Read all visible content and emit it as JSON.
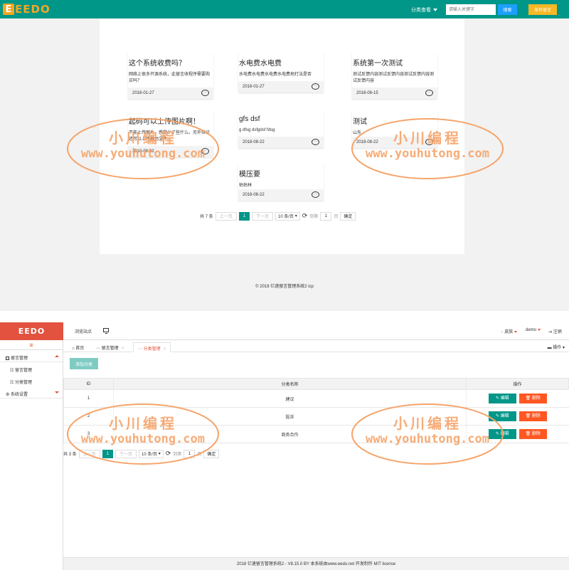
{
  "front": {
    "logo": {
      "mark": "E",
      "text": "EEDO"
    },
    "nav": {
      "category_menu": "分类查看",
      "search_placeholder": "请输入关键字",
      "search_button": "搜索",
      "post_button": "发布留言"
    },
    "cards": [
      {
        "title": "这个系统收费吗？",
        "summary": "网络上很多开源系统，此留言收程序需要购买吗？",
        "date": "2016-01-27"
      },
      {
        "title": "水电费水电费",
        "summary": "水电费水电费水电费水电费地打法是否",
        "date": "2016-01-27"
      },
      {
        "title": "系统第一次测试",
        "summary": "测试反馈内容测试反馈内容测试反馈内容测试反馈内容",
        "date": "2018-08-15"
      },
      {
        "title": "起码可以上传图片啊！",
        "summary": "不能上传图片，感觉少了些什么。另外验证还可以上传其他文件。",
        "date": "2018-08-22"
      },
      {
        "title": "gfs dsf",
        "summary": "g dfsg dsfgdsf fdsg",
        "date": "2018-08-22"
      },
      {
        "title": "测试",
        "summary": "山东",
        "date": "2018-08-22"
      },
      {
        "title": "模压要",
        "summary": "枯枯林",
        "date": "2018-08-22"
      }
    ],
    "pager": {
      "total": "共 7 条",
      "prev": "上一页",
      "current": "1",
      "next": "下一页",
      "page_size": "10 条/页",
      "goto_label": "到第",
      "goto_value": "1",
      "page_unit": "页",
      "confirm": "确定"
    },
    "footer": "© 2018 亿速留言管理系统2  icp"
  },
  "admin": {
    "logo": "EEDO",
    "header": {
      "preview": "浏览站点",
      "skin": "皮肤",
      "user": "demo",
      "logout": "注销"
    },
    "sidebar": {
      "toggle": "≡",
      "groups": [
        {
          "label": "留言管理",
          "items": [
            "留言管理",
            "分类管理"
          ]
        },
        {
          "label": "系统设置",
          "items": []
        }
      ]
    },
    "tabs": [
      {
        "label": "首页",
        "closable": false
      },
      {
        "label": "留言管理",
        "closable": true
      },
      {
        "label": "分类管理",
        "closable": true
      }
    ],
    "tab_ops": "操作",
    "add_button": "添加分类",
    "table": {
      "headers": [
        "ID",
        "分类名称",
        "操作"
      ],
      "rows": [
        {
          "id": "1",
          "name": "建议"
        },
        {
          "id": "2",
          "name": "投诉"
        },
        {
          "id": "3",
          "name": "商务合作"
        }
      ],
      "edit_label": "编辑",
      "delete_label": "删除"
    },
    "pager": {
      "total": "共 3 条",
      "prev": "上一页",
      "current": "1",
      "next": "下一页",
      "page_size": "10 条/页",
      "goto_label": "到第",
      "goto_value": "1",
      "page_unit": "页",
      "confirm": "确定"
    },
    "footer": "2018   亿速留言管理系统2 - V8.15.0 BY 本系统由www.eedo.net 开发制作 MIT license"
  },
  "watermark": {
    "line1": "小川编程",
    "line2": "www.youhutong.com"
  },
  "colors": {
    "primary": "#009688",
    "accent": "#e2523f",
    "danger": "#ff5722",
    "warn": "#f7b824",
    "info": "#1e9fff"
  }
}
